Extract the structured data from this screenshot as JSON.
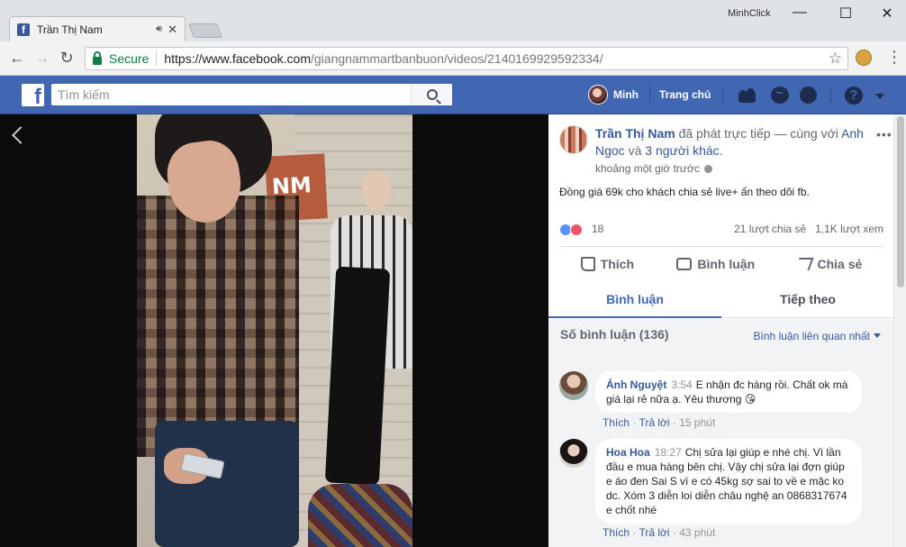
{
  "browser": {
    "tab_title": "Trần Thị Nam",
    "profile_name": "MinhClick",
    "secure_label": "Secure",
    "url_scheme": "https://",
    "url_host": "www.facebook.com",
    "url_path": "/giangnammartbanbuon/videos/2140169929592334/"
  },
  "fb_header": {
    "search_placeholder": "Tìm kiếm",
    "user_name": "Minh",
    "home_label": "Trang chủ"
  },
  "post": {
    "author": "Trần Thị Nam",
    "live_text": " đã phát trực tiếp — cùng với ",
    "with_name": "Anh Ngoc",
    "and_text": " và ",
    "others": "3 người khác",
    "period": ".",
    "time": "khoảng một giờ trước",
    "message": "Đồng giá 69k cho khách chia sẻ live+ ấn theo dõi fb.",
    "reaction_count": "18",
    "shares_views": "21 lượt chia sẻ   1,1K lượt xem",
    "more": "•••"
  },
  "actions": {
    "like": "Thích",
    "comment": "Bình luận",
    "share": "Chia sẻ"
  },
  "tabs": {
    "comments": "Bình luận",
    "follow": "Tiếp theo"
  },
  "comments_section": {
    "count_label": "Số bình luận (136)",
    "sort_label": "Bình luận liên quan nhất",
    "items": [
      {
        "name": "Ánh Nguyệt",
        "time": "3:54",
        "text": "E nhận đc hàng rồi. Chất ok mà giá lại rẻ nữa ạ. Yêu thương 😘",
        "like": "Thích",
        "reply": "Trả lời",
        "ago": "15 phút"
      },
      {
        "name": "Hoa Hoa",
        "time": "18:27",
        "text": "Chị sửa lại giúp e nhé chị. Vì lần đầu e mua hàng bên chị. Vậy chị sửa lại đợn giúp e áo đen Sai S vì e có 45kg sợ sai to về e mặc ko dc. Xóm 3 diễn loi diễn châu nghệ an 0868317674 e chốt nhé",
        "like": "Thích",
        "reply": "Trả lời",
        "ago": "43 phút"
      }
    ]
  },
  "colors": {
    "fb_blue": "#4267b2",
    "link_blue": "#365899",
    "secure_green": "#0b8043"
  }
}
